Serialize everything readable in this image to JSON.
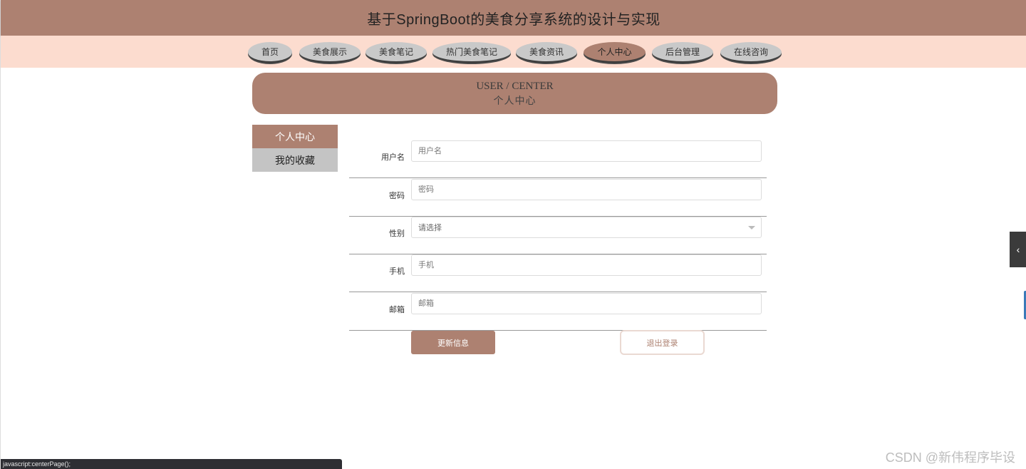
{
  "header": {
    "title": "基于SpringBoot的美食分享系统的设计与实现"
  },
  "nav": {
    "items": [
      {
        "label": "首页"
      },
      {
        "label": "美食展示"
      },
      {
        "label": "美食笔记"
      },
      {
        "label": "热门美食笔记"
      },
      {
        "label": "美食资讯"
      },
      {
        "label": "个人中心",
        "active": true
      },
      {
        "label": "后台管理"
      },
      {
        "label": "在线咨询"
      }
    ]
  },
  "banner": {
    "en": "USER / CENTER",
    "cn": "个人中心"
  },
  "sidebar": {
    "items": [
      {
        "label": "个人中心",
        "active": true
      },
      {
        "label": "我的收藏"
      }
    ]
  },
  "form": {
    "username": {
      "label": "用户名",
      "placeholder": "用户名"
    },
    "password": {
      "label": "密码",
      "placeholder": "密码"
    },
    "gender": {
      "label": "性别",
      "placeholder": "请选择"
    },
    "phone": {
      "label": "手机",
      "placeholder": "手机"
    },
    "email": {
      "label": "邮箱",
      "placeholder": "邮箱"
    }
  },
  "buttons": {
    "update": "更新信息",
    "logout": "退出登录"
  },
  "statusbar": {
    "text": "javascript:centerPage();"
  },
  "watermark": {
    "text": "CSDN @新伟程序毕设"
  },
  "colors": {
    "brand": "#ad8171",
    "nav_bg": "#fcdccf",
    "inactive": "#c4c4c4"
  },
  "icons": {
    "cursor": "mouse-pointer-icon",
    "side_tab": "chevron-left-icon",
    "select": "caret-down-icon"
  }
}
